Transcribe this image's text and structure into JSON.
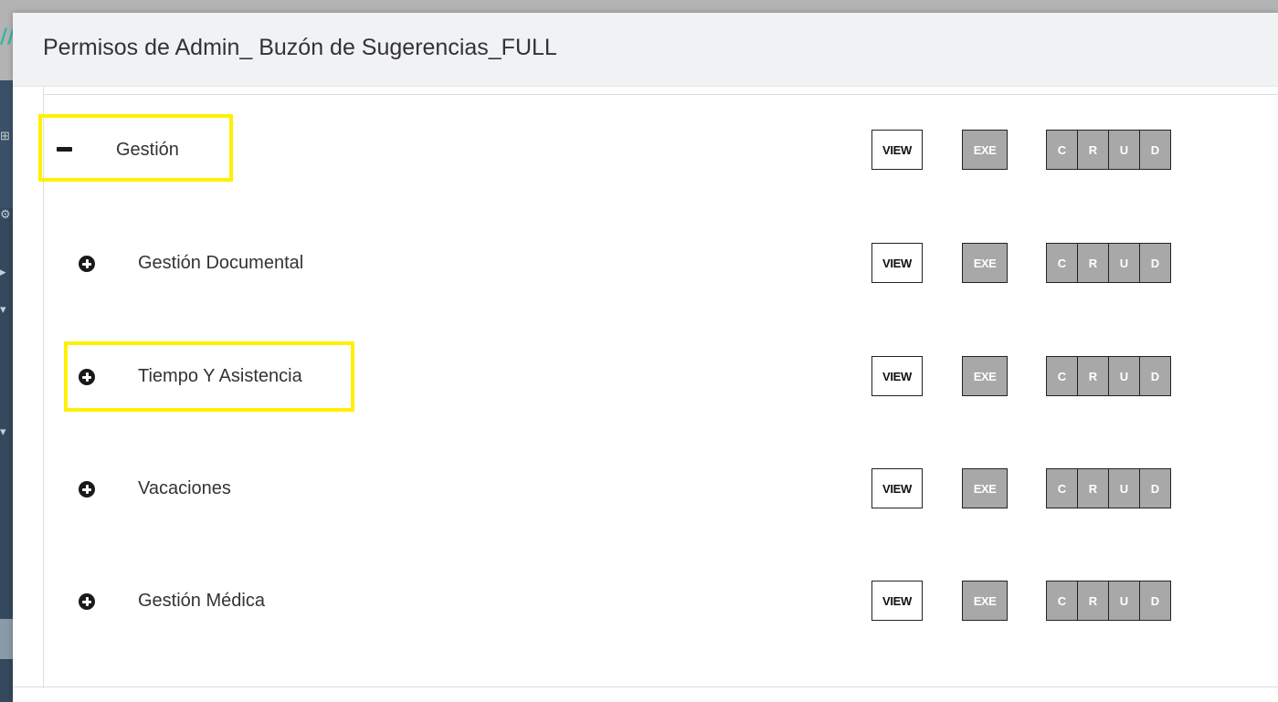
{
  "modal": {
    "title": "Permisos de Admin_ Buzón de Sugerencias_FULL"
  },
  "tree": {
    "root": {
      "label": "Gestión",
      "toggle_icon": "minus-icon",
      "buttons": {
        "view": "VIEW",
        "exe": "EXE",
        "crud": [
          "C",
          "R",
          "U",
          "D"
        ]
      }
    },
    "children": [
      {
        "label": "Gestión Documental",
        "toggle_icon": "plus-circle-icon",
        "buttons": {
          "view": "VIEW",
          "exe": "EXE",
          "crud": [
            "C",
            "R",
            "U",
            "D"
          ]
        }
      },
      {
        "label": "Tiempo Y Asistencia",
        "toggle_icon": "plus-circle-icon",
        "buttons": {
          "view": "VIEW",
          "exe": "EXE",
          "crud": [
            "C",
            "R",
            "U",
            "D"
          ]
        }
      },
      {
        "label": "Vacaciones",
        "toggle_icon": "plus-circle-icon",
        "buttons": {
          "view": "VIEW",
          "exe": "EXE",
          "crud": [
            "C",
            "R",
            "U",
            "D"
          ]
        }
      },
      {
        "label": "Gestión Médica",
        "toggle_icon": "plus-circle-icon",
        "buttons": {
          "view": "VIEW",
          "exe": "EXE",
          "crud": [
            "C",
            "R",
            "U",
            "D"
          ]
        }
      }
    ]
  },
  "colors": {
    "highlight": "#fff000",
    "button_disabled_bg": "#a8a8a8",
    "header_bg": "#f1f2f4",
    "sidebar_bg": "#34495e"
  }
}
